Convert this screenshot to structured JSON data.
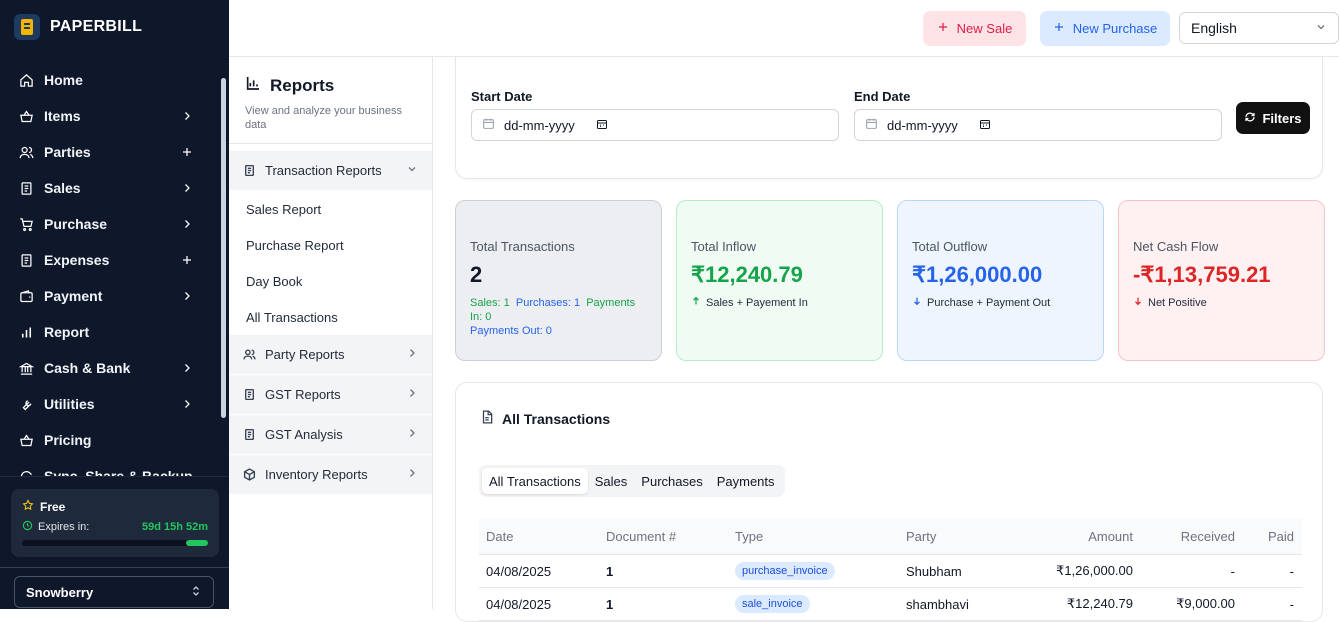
{
  "app": {
    "name": "PAPERBILL"
  },
  "sidebar": {
    "items": [
      {
        "label": "Home",
        "icon": "home-icon",
        "trail": ""
      },
      {
        "label": "Items",
        "icon": "basket-icon",
        "trail": "chevron"
      },
      {
        "label": "Parties",
        "icon": "users-icon",
        "trail": "plus"
      },
      {
        "label": "Sales",
        "icon": "receipt-icon",
        "trail": "chevron"
      },
      {
        "label": "Purchase",
        "icon": "cart-icon",
        "trail": "chevron"
      },
      {
        "label": "Expenses",
        "icon": "receipt-icon",
        "trail": "plus"
      },
      {
        "label": "Payment",
        "icon": "wallet-icon",
        "trail": "chevron"
      },
      {
        "label": "Report",
        "icon": "bar-chart-icon",
        "trail": ""
      },
      {
        "label": "Cash & Bank",
        "icon": "bank-icon",
        "trail": "chevron"
      },
      {
        "label": "Utilities",
        "icon": "wrench-icon",
        "trail": "chevron"
      },
      {
        "label": "Pricing",
        "icon": "basket-icon",
        "trail": ""
      },
      {
        "label": "Sync, Share & Backup",
        "icon": "sync-icon",
        "trail": ""
      }
    ],
    "plan": {
      "name": "Free",
      "expires_label": "Expires in:",
      "remaining": "59d 15h 52m",
      "progress": 0.12
    },
    "company": "Snowberry"
  },
  "topbar": {
    "new_sale": "New Sale",
    "new_purchase": "New Purchase",
    "language": "English"
  },
  "reports": {
    "title": "Reports",
    "subtitle": "View and analyze your business data",
    "groups": [
      {
        "label": "Transaction Reports",
        "open": true,
        "icon": "file-icon",
        "items": [
          "Sales Report",
          "Purchase Report",
          "Day Book",
          "All Transactions"
        ]
      },
      {
        "label": "Party Reports",
        "open": false,
        "icon": "users-icon"
      },
      {
        "label": "GST Reports",
        "open": false,
        "icon": "file-icon"
      },
      {
        "label": "GST Analysis",
        "open": false,
        "icon": "file-icon"
      },
      {
        "label": "Inventory Reports",
        "open": false,
        "icon": "box-icon"
      }
    ]
  },
  "filters": {
    "start_label": "Start Date",
    "end_label": "End Date",
    "start_placeholder": "dd-mm-yyyy",
    "end_placeholder": "dd-mm-yyyy",
    "button": "Filters"
  },
  "stats": {
    "total": {
      "title": "Total Transactions",
      "value": "2",
      "sales": "Sales: 1",
      "purchases": "Purchases: 1",
      "payments_in": "Payments In: 0",
      "payments_out": "Payments Out: 0"
    },
    "inflow": {
      "title": "Total Inflow",
      "value": "₹12,240.79",
      "desc": "Sales + Payement In",
      "color": "#16a34a"
    },
    "outflow": {
      "title": "Total Outflow",
      "value": "₹1,26,000.00",
      "desc": "Purchase + Payment Out",
      "color": "#2563eb"
    },
    "net": {
      "title": "Net Cash Flow",
      "value": "-₹1,13,759.21",
      "desc": "Net Positive",
      "color": "#dc2626"
    }
  },
  "transactions": {
    "title": "All Transactions",
    "tabs": [
      "All Transactions",
      "Sales",
      "Purchases",
      "Payments"
    ],
    "active_tab": 0,
    "columns": [
      "Date",
      "Document #",
      "Type",
      "Party",
      "Amount",
      "Received",
      "Paid"
    ],
    "rows": [
      {
        "date": "04/08/2025",
        "doc": "1",
        "type": "purchase_invoice",
        "party": "Shubham",
        "amount": "₹1,26,000.00",
        "received": "-",
        "paid": "-"
      },
      {
        "date": "04/08/2025",
        "doc": "1",
        "type": "sale_invoice",
        "party": "shambhavi",
        "amount": "₹12,240.79",
        "received": "₹9,000.00",
        "paid": "-"
      }
    ]
  }
}
